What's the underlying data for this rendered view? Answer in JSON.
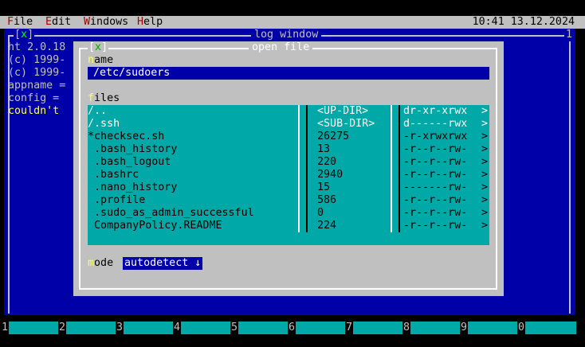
{
  "menubar": {
    "items": [
      {
        "hotkey": "F",
        "rest": "ile"
      },
      {
        "hotkey": "E",
        "rest": "dit"
      },
      {
        "hotkey": "W",
        "rest": "indows"
      },
      {
        "hotkey": "H",
        "rest": "elp"
      }
    ],
    "clock": "10:41 13.12.2024"
  },
  "log_window": {
    "title": "log window",
    "close": "[x]",
    "close_x": "x",
    "number": "1",
    "lines": [
      "ht 2.0.18",
      "(c) 1999-",
      "(c) 1999-",
      "appname =",
      "config =",
      "couldn't"
    ]
  },
  "dialog": {
    "title": "open file",
    "close_x": "x",
    "name_label": {
      "hotkey": "n",
      "rest": "ame"
    },
    "name_value": "/etc/sudoers",
    "files_label": {
      "hotkey": "f",
      "rest": "iles"
    },
    "files": [
      {
        "name": "/..",
        "size": "<UP-DIR>",
        "perm": "dr-xr-xrwx"
      },
      {
        "name": "/.ssh",
        "size": "<SUB-DIR>",
        "perm": "d------rwx"
      },
      {
        "name": "*checksec.sh",
        "size": "26275",
        "perm": "-r-xrwxrwx"
      },
      {
        "name": " .bash_history",
        "size": "13",
        "perm": "-r--r--rw-"
      },
      {
        "name": " .bash_logout",
        "size": "220",
        "perm": "-r--r--rw-"
      },
      {
        "name": " .bashrc",
        "size": "2940",
        "perm": "-r--r--rw-"
      },
      {
        "name": " .nano_history",
        "size": "15",
        "perm": "-------rw-"
      },
      {
        "name": " .profile",
        "size": "586",
        "perm": "-r--r--rw-"
      },
      {
        "name": " .sudo_as_admin_successful",
        "size": "0",
        "perm": "-r--r--rw-"
      },
      {
        "name": " CompanyPolicy.README",
        "size": "224",
        "perm": "-r--r--rw-"
      }
    ],
    "arrow": ">",
    "mode_label": {
      "hotkey": "m",
      "rest": "ode"
    },
    "mode_value": "autodetect ↓"
  },
  "fkeys": [
    "1",
    "2",
    "3",
    "4",
    "5",
    "6",
    "7",
    "8",
    "9",
    "0"
  ]
}
